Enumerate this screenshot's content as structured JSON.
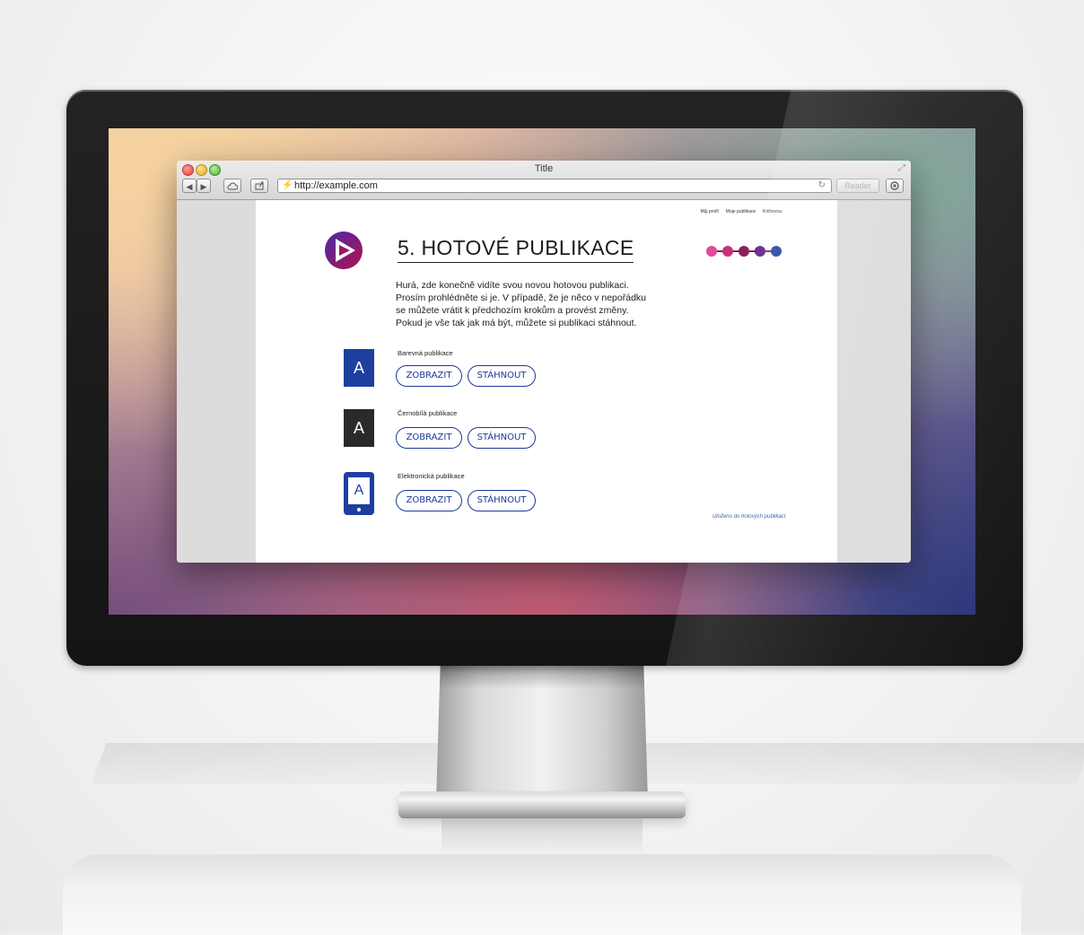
{
  "browser": {
    "window_title": "Title",
    "url": "http://example.com",
    "reader_label": "Reader"
  },
  "page": {
    "nav": [
      "Můj profil",
      "Moje publikace",
      "Knihovna"
    ],
    "title": "5. HOTOVÉ PUBLIKACE",
    "intro_lines": [
      "Hurá, zde konečně vidíte svou novou hotovou publikaci.",
      "Prosím prohlédněte si je. V případě, že je něco v nepořádku",
      "se můžete vrátit k předchozím krokům a provést změny.",
      "Pokud je vše tak jak má být, můžete si publikaci stáhnout."
    ],
    "publications": [
      {
        "label": "Barevná publikace",
        "icon_letter": "A",
        "icon_color": "#1e3fa0",
        "view_label": "ZOBRAZIT",
        "download_label": "STÁHNOUT"
      },
      {
        "label": "Černobílá publikace",
        "icon_letter": "A",
        "icon_color": "#2a2a2a",
        "view_label": "ZOBRAZIT",
        "download_label": "STÁHNOUT"
      },
      {
        "label": "Elektronická publikace",
        "icon_letter": "A",
        "icon_color": "#1e3fa0",
        "view_label": "ZOBRAZIT",
        "download_label": "STÁHNOUT"
      }
    ],
    "saved_note": "Uloženo do hotových publikací.",
    "progress_colors": [
      "#e5479a",
      "#c4347a",
      "#8e1f5a",
      "#5a1d82",
      "#1e3fa0"
    ],
    "progress_step": 5,
    "progress_total": 5
  }
}
